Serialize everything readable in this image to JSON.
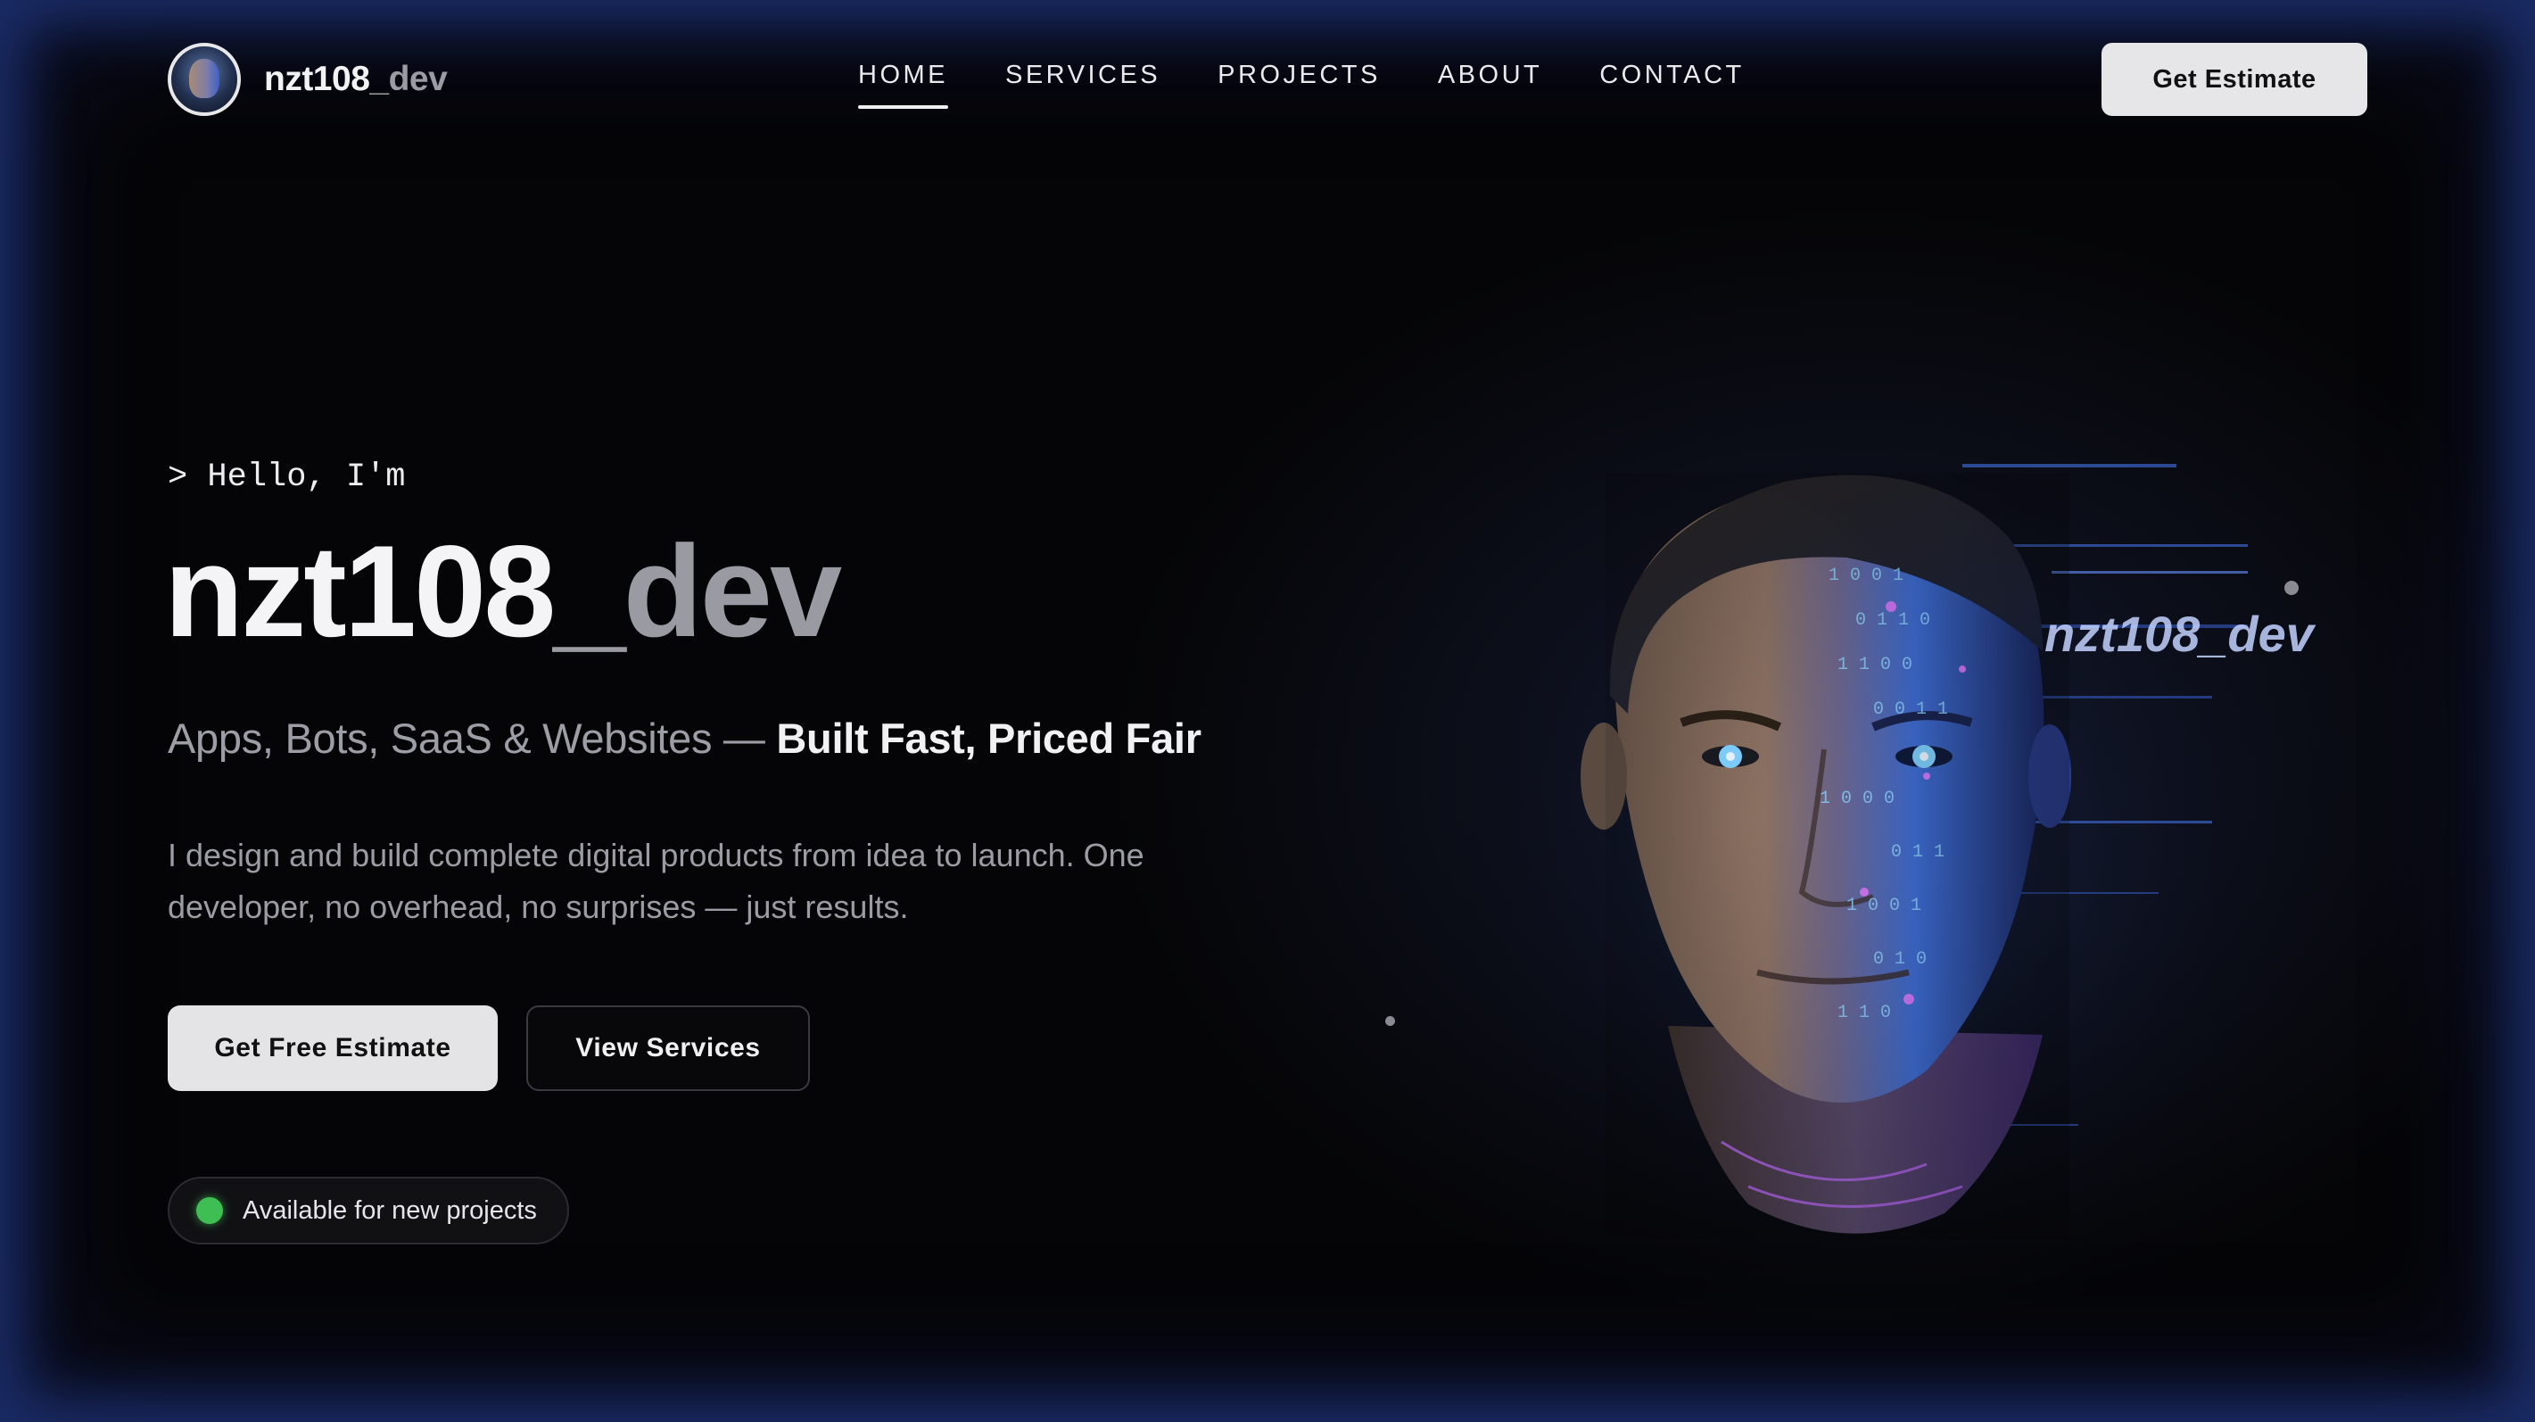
{
  "nav": {
    "logo_text_main": "nzt108",
    "logo_text_muted": "_dev",
    "items": [
      {
        "label": "HOME",
        "active": true
      },
      {
        "label": "SERVICES",
        "active": false
      },
      {
        "label": "PROJECTS",
        "active": false
      },
      {
        "label": "ABOUT",
        "active": false
      },
      {
        "label": "CONTACT",
        "active": false
      }
    ],
    "cta_label": "Get Estimate"
  },
  "hero": {
    "greeting": "> Hello, I'm",
    "title_main": "nzt108",
    "title_muted": "_dev",
    "tagline_muted": "Apps, Bots, SaaS & Websites — ",
    "tagline_strong": "Built Fast, Priced Fair",
    "description": "I design and build complete digital products from idea to launch. One developer, no overhead, no surprises — just results.",
    "primary_button": "Get Free Estimate",
    "secondary_button": "View Services",
    "status_text": "Available for new projects"
  },
  "portrait": {
    "overlay_label": "nzt108_dev",
    "binary_text": "1001 0110 1100 0011"
  },
  "colors": {
    "background": "#050507",
    "glow": "#2846a0",
    "status": "#3fbf53",
    "accent_blue": "#5ab8ff",
    "accent_pink": "#d55cff"
  }
}
